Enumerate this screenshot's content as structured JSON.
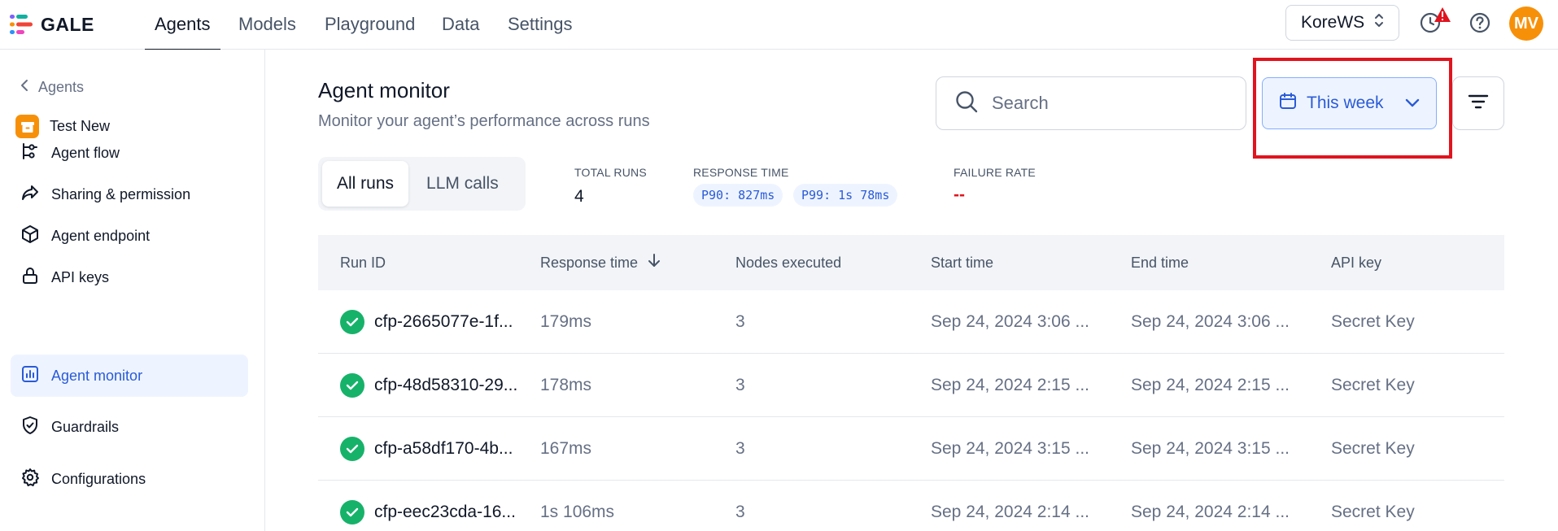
{
  "app": {
    "logo_text": "GALE"
  },
  "topnav": {
    "tabs": [
      {
        "label": "Agents",
        "active": true
      },
      {
        "label": "Models",
        "active": false
      },
      {
        "label": "Playground",
        "active": false
      },
      {
        "label": "Data",
        "active": false
      },
      {
        "label": "Settings",
        "active": false
      }
    ],
    "workspace": "KoreWS",
    "avatar_initials": "MV",
    "icons": [
      "history-alert-icon",
      "help-icon"
    ]
  },
  "sidebar": {
    "back_label": "Agents",
    "agent_name": "Test New",
    "items": [
      {
        "label": "Agent flow",
        "icon": "flow-icon",
        "active": false
      },
      {
        "label": "Sharing & permission",
        "icon": "share-icon",
        "active": false
      },
      {
        "label": "Agent endpoint",
        "icon": "cube-icon",
        "active": false
      },
      {
        "label": "API keys",
        "icon": "lock-icon",
        "active": false
      },
      {
        "label": "Agent monitor",
        "icon": "chart-icon",
        "active": true
      },
      {
        "label": "Guardrails",
        "icon": "shield-icon",
        "active": false
      },
      {
        "label": "Configurations",
        "icon": "gear-icon",
        "active": false
      }
    ]
  },
  "header": {
    "title": "Agent monitor",
    "subtitle": "Monitor your agent’s performance across runs"
  },
  "search": {
    "placeholder": "Search",
    "value": ""
  },
  "date_filter": {
    "label": "This week"
  },
  "segments": [
    {
      "label": "All runs",
      "active": true
    },
    {
      "label": "LLM calls",
      "active": false
    }
  ],
  "stats": {
    "total_runs_label": "TOTAL RUNS",
    "total_runs_value": "4",
    "response_time_label": "RESPONSE TIME",
    "p90": "P90: 827ms",
    "p99": "P99: 1s 78ms",
    "failure_rate_label": "FAILURE RATE",
    "failure_rate_value": "--"
  },
  "table": {
    "columns": [
      "Run ID",
      "Response time",
      "Nodes executed",
      "Start time",
      "End time",
      "API key"
    ],
    "rows": [
      {
        "run_id": "cfp-2665077e-1f...",
        "response_time": "179ms",
        "nodes": "3",
        "start": "Sep 24, 2024 3:06 ...",
        "end": "Sep 24, 2024 3:06 ...",
        "api_key": "Secret Key"
      },
      {
        "run_id": "cfp-48d58310-29...",
        "response_time": "178ms",
        "nodes": "3",
        "start": "Sep 24, 2024 2:15 ...",
        "end": "Sep 24, 2024 2:15 ...",
        "api_key": "Secret Key"
      },
      {
        "run_id": "cfp-a58df170-4b...",
        "response_time": "167ms",
        "nodes": "3",
        "start": "Sep 24, 2024 3:15 ...",
        "end": "Sep 24, 2024 3:15 ...",
        "api_key": "Secret Key"
      },
      {
        "run_id": "cfp-eec23cda-16...",
        "response_time": "1s 106ms",
        "nodes": "3",
        "start": "Sep 24, 2024 2:14 ...",
        "end": "Sep 24, 2024 2:14 ...",
        "api_key": "Secret Key"
      }
    ]
  },
  "colors": {
    "accent": "#2a5bd7",
    "success": "#17b26a",
    "danger": "#e0141e",
    "avatar": "#f79009"
  }
}
